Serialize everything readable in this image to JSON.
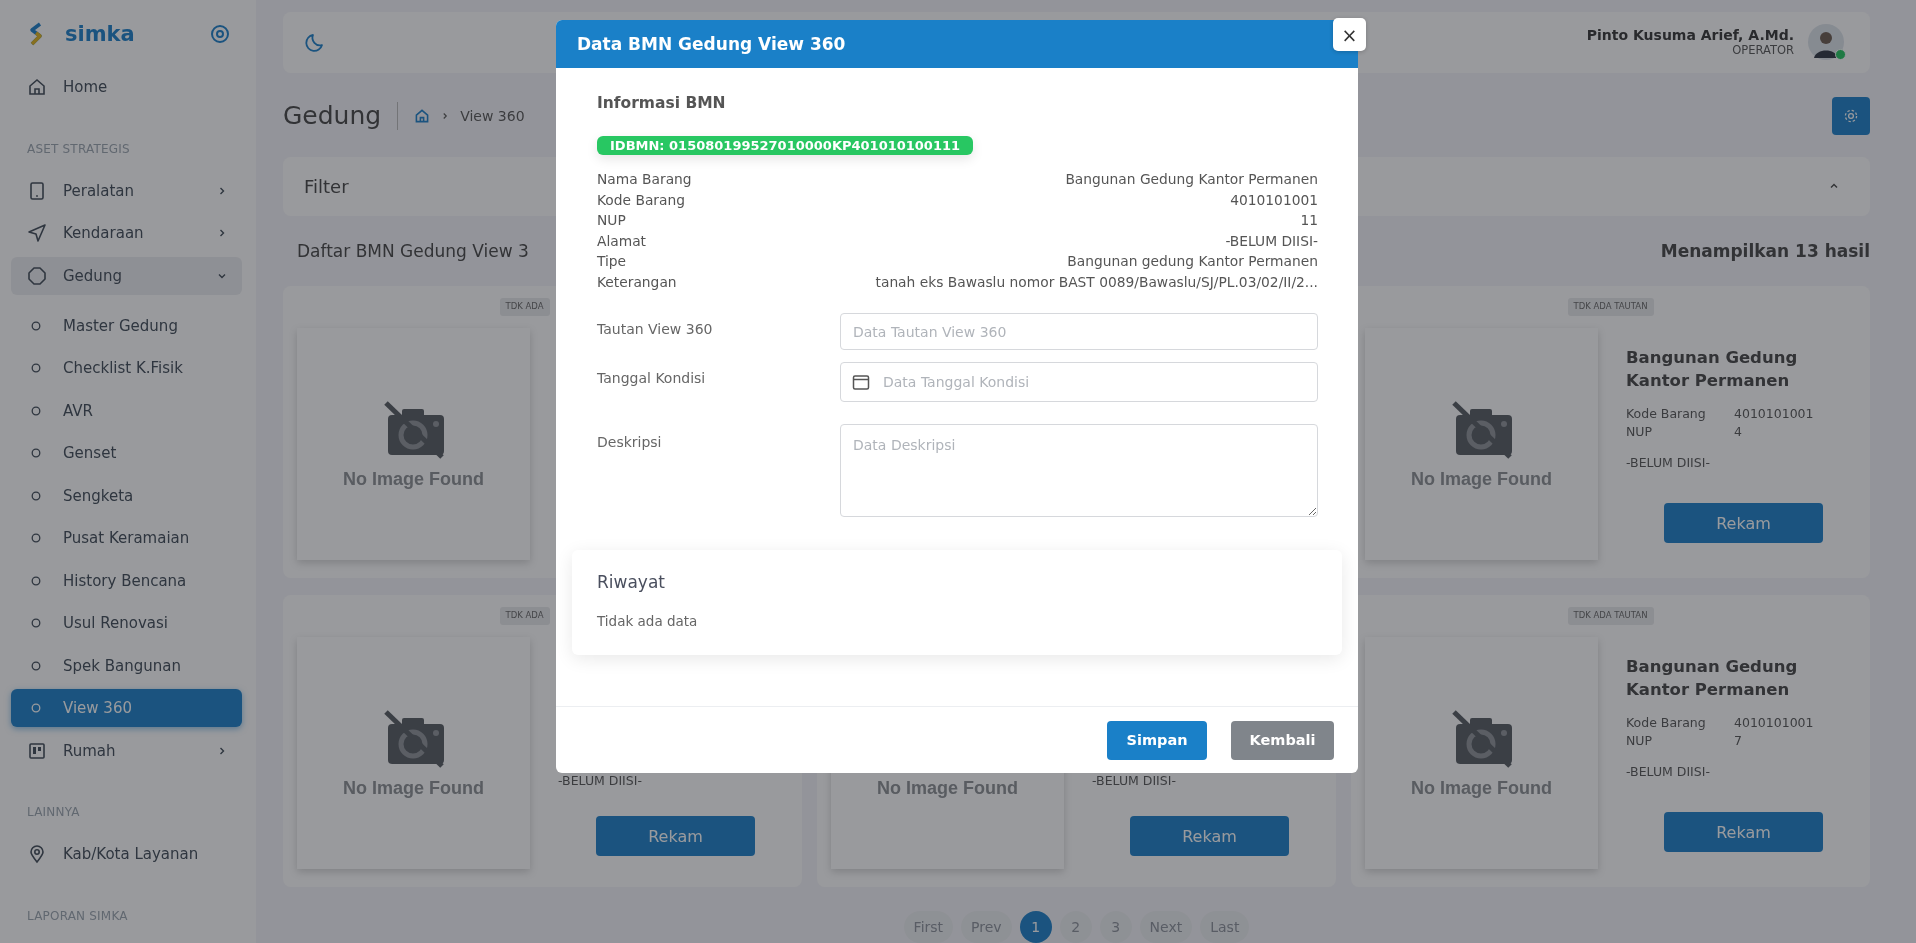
{
  "sidebar": {
    "brand": "simka",
    "items": [
      {
        "kind": "item",
        "label": "Home",
        "selected": false
      },
      {
        "kind": "section",
        "label": "ASET STRATEGIS"
      },
      {
        "kind": "item",
        "label": "Peralatan",
        "selected": false,
        "expanded": false
      },
      {
        "kind": "item",
        "label": "Kendaraan",
        "selected": false,
        "expanded": false
      },
      {
        "kind": "item",
        "label": "Gedung",
        "selected": false,
        "expanded": true
      },
      {
        "kind": "subitem",
        "label": "Master Gedung",
        "selected": false
      },
      {
        "kind": "subitem",
        "label": "Checklist K.Fisik",
        "selected": false
      },
      {
        "kind": "subitem",
        "label": "AVR",
        "selected": false
      },
      {
        "kind": "subitem",
        "label": "Genset",
        "selected": false
      },
      {
        "kind": "subitem",
        "label": "Sengketa",
        "selected": false
      },
      {
        "kind": "subitem",
        "label": "Pusat Keramaian",
        "selected": false
      },
      {
        "kind": "subitem",
        "label": "History Bencana",
        "selected": false
      },
      {
        "kind": "subitem",
        "label": "Usul Renovasi",
        "selected": false
      },
      {
        "kind": "subitem",
        "label": "Spek Bangunan",
        "selected": false
      },
      {
        "kind": "subitem",
        "label": "View 360",
        "selected": true
      },
      {
        "kind": "item",
        "label": "Rumah",
        "selected": false,
        "expanded": false
      },
      {
        "kind": "section",
        "label": "LAINNYA"
      },
      {
        "kind": "item",
        "label": "Kab/Kota Layanan",
        "selected": false
      },
      {
        "kind": "section",
        "label": "LAPORAN SIMKA"
      }
    ]
  },
  "topbar": {
    "user_name": "Pinto Kusuma Arief, A.Md.",
    "user_role": "OPERATOR",
    "online": true
  },
  "page": {
    "title": "Gedung",
    "breadcrumb": "View 360"
  },
  "filter": {
    "label": "Filter",
    "expanded": true
  },
  "list": {
    "heading": "Daftar BMN Gedung View 3",
    "count": "Menampilkan 13 hasil"
  },
  "cards": [
    {
      "kind": "card",
      "badge": "TDK ADA",
      "image_text": "No Image Found"
    },
    {
      "kind": "card"
    },
    {
      "kind": "card",
      "badge": "TDK ADA TAUTAN",
      "image_text": "No Image Found",
      "title": "Bangunan Gedung Kantor Permanen",
      "fields": [
        {
          "label": "Kode Barang",
          "value": "4010101001"
        },
        {
          "label": "NUP",
          "value": "4"
        }
      ],
      "address": "-BELUM DIISI-",
      "button": "Rekam"
    },
    {
      "kind": "card",
      "badge": "TDK ADA",
      "image_text": "No Image Found",
      "address": "-BELUM DIISI-",
      "button": "Rekam"
    },
    {
      "kind": "card",
      "image_text": "No Image Found",
      "address": "-BELUM DIISI-",
      "button": "Rekam"
    },
    {
      "kind": "card",
      "badge": "TDK ADA TAUTAN",
      "image_text": "No Image Found",
      "title": "Bangunan Gedung Kantor Permanen",
      "fields": [
        {
          "label": "Kode Barang",
          "value": "4010101001"
        },
        {
          "label": "NUP",
          "value": "7"
        }
      ],
      "address": "-BELUM DIISI-",
      "button": "Rekam"
    }
  ],
  "pagination": [
    {
      "label": "First",
      "selected": false
    },
    {
      "label": "Prev",
      "selected": false
    },
    {
      "label": "1",
      "selected": true
    },
    {
      "label": "2",
      "selected": false
    },
    {
      "label": "3",
      "selected": false
    },
    {
      "label": "Next",
      "selected": false
    },
    {
      "label": "Last",
      "selected": false
    }
  ],
  "modal": {
    "title": "Data BMN Gedung View 360",
    "close": "×",
    "info_heading": "Informasi BMN",
    "id_badge": "IDBMN: 015080199527010000KP401010100111",
    "info_rows": [
      {
        "label": "Nama Barang",
        "value": "Bangunan Gedung Kantor Permanen"
      },
      {
        "label": "Kode Barang",
        "value": "4010101001"
      },
      {
        "label": "NUP",
        "value": "11"
      },
      {
        "label": "Alamat",
        "value": "-BELUM DIISI-"
      },
      {
        "label": "Tipe",
        "value": "Bangunan gedung Kantor Permanen"
      },
      {
        "label": "Keterangan",
        "value": "tanah eks Bawaslu nomor BAST 0089/Bawaslu/SJ/PL.03/02/II/2..."
      }
    ],
    "fields": [
      {
        "kind": "text",
        "label": "Tautan View 360",
        "placeholder": "Data Tautan View 360"
      },
      {
        "kind": "date",
        "label": "Tanggal Kondisi",
        "placeholder": "Data Tanggal Kondisi"
      },
      {
        "kind": "textarea",
        "label": "Deskripsi",
        "placeholder": "Data Deskripsi"
      }
    ],
    "history": {
      "title": "Riwayat",
      "empty": "Tidak ada data"
    },
    "buttons": [
      {
        "kind": "primary",
        "label": "Simpan"
      },
      {
        "kind": "secondary",
        "label": "Kembali"
      }
    ]
  }
}
